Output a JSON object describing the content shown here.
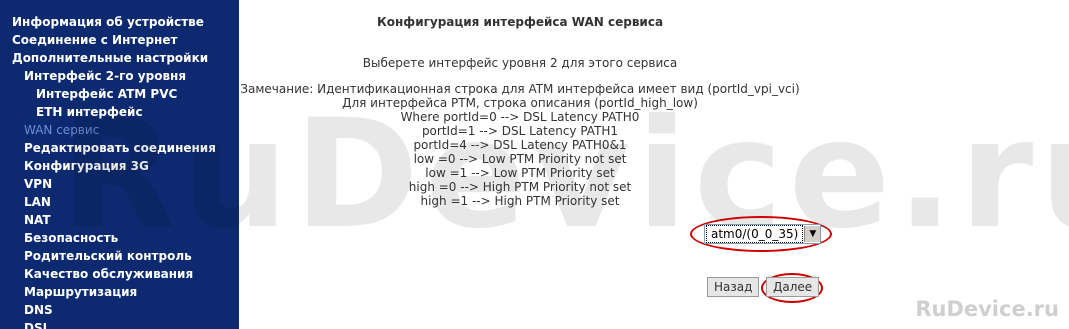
{
  "sidebar": {
    "items": [
      {
        "label": "Информация об устройстве",
        "level": 0
      },
      {
        "label": "Соединение с Интернет",
        "level": 0
      },
      {
        "label": "Дополнительные настройки",
        "level": 0
      },
      {
        "label": "Интерфейс 2-го уровня",
        "level": 1
      },
      {
        "label": "Интерфейс ATM PVC",
        "level": 2
      },
      {
        "label": "ETH интерфейс",
        "level": 2
      },
      {
        "label": "WAN сервис",
        "level": 1,
        "active": true
      },
      {
        "label": "Редактировать соединения",
        "level": 1
      },
      {
        "label": "Конфигурация 3G",
        "level": 1
      },
      {
        "label": "VPN",
        "level": 1
      },
      {
        "label": "LAN",
        "level": 1
      },
      {
        "label": "NAT",
        "level": 1
      },
      {
        "label": "Безопасность",
        "level": 1
      },
      {
        "label": "Родительский контроль",
        "level": 1
      },
      {
        "label": "Качество обслуживания",
        "level": 1
      },
      {
        "label": "Маршрутизация",
        "level": 1
      },
      {
        "label": "DNS",
        "level": 1
      },
      {
        "label": "DSL",
        "level": 1
      }
    ]
  },
  "main": {
    "title": "Конфигурация интерфейса WAN сервиса",
    "subtitle": "Выберете интерфейс уровня 2 для этого сервиса",
    "notes": [
      "Замечание: Идентификационная строка для ATM интерфейса имеет вид (portId_vpi_vci)",
      "Для интерфейса PTM, строка описания (portId_high_low)",
      "Where portId=0 --> DSL Latency PATH0",
      "portId=1 --> DSL Latency PATH1",
      "portId=4 --> DSL Latency PATH0&1",
      "low =0 --> Low PTM Priority not set",
      "low =1 --> Low PTM Priority set",
      "high =0 --> High PTM Priority not set",
      "high =1 --> High PTM Priority set"
    ],
    "interface_select": {
      "value": "atm0/(0_0_35)"
    },
    "back_button": "Назад",
    "next_button": "Далее"
  },
  "watermark": "RuDevice.ru",
  "logo": "RuDevice.ru",
  "colors": {
    "sidebar_bg": "#0d2a70",
    "highlight": "#d00000"
  }
}
